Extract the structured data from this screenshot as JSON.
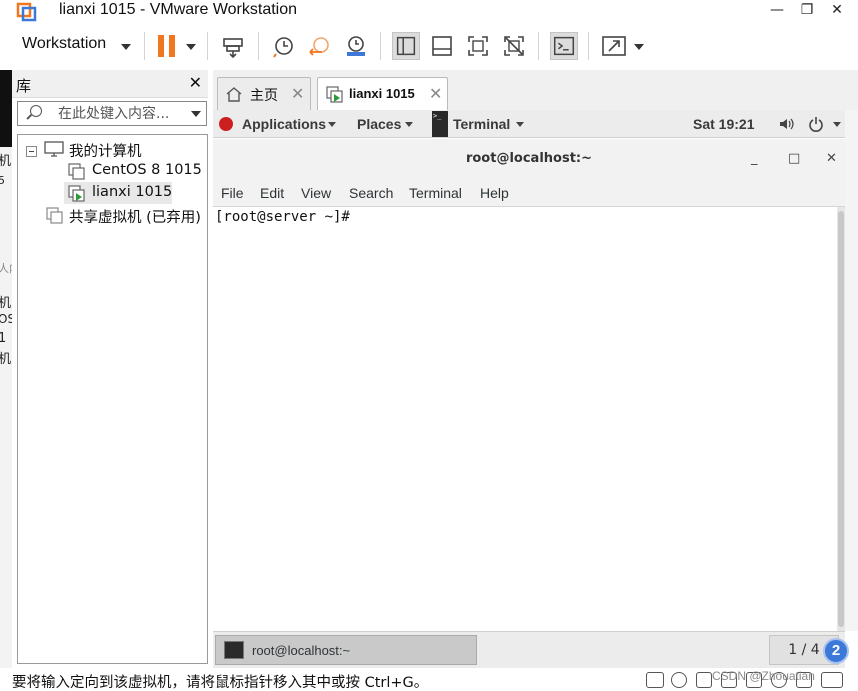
{
  "window": {
    "title": "lianxi 1015 - VMware Workstation",
    "minimize_glyph": "—",
    "restore_glyph": "❐",
    "close_glyph": "✕"
  },
  "toolbar": {
    "menu_label": "Workstation",
    "buttons": [
      "pause-vm",
      "send-ctrl-alt-del",
      "snapshot",
      "revert-snapshot",
      "manage-snapshots",
      "show-library",
      "thumbnail-bar",
      "full-screen",
      "unity",
      "console-view",
      "stretch-guest"
    ]
  },
  "library": {
    "title": "库",
    "close_glyph": "✕",
    "search_placeholder": "在此处键入内容...",
    "tree": [
      {
        "label": "我的计算机",
        "icon": "computer-icon"
      },
      {
        "label": "CentOS 8 1015",
        "icon": "vm-icon"
      },
      {
        "label": "lianxi 1015",
        "icon": "vm-running-icon",
        "selected": true
      },
      {
        "label": "共享虚拟机 (已弃用)",
        "icon": "shared-vm-icon"
      }
    ]
  },
  "tabs": [
    {
      "label": "主页",
      "icon": "home-icon",
      "close": "✕"
    },
    {
      "label": "lianxi 1015",
      "icon": "vm-running-icon",
      "close": "✕",
      "active": true
    }
  ],
  "guest": {
    "topbar": {
      "applications": "Applications",
      "places": "Places",
      "terminal": "Terminal",
      "clock": "Sat 19:21"
    },
    "window_title": "root@localhost:~",
    "window_controls": {
      "minimize": "_",
      "maximize": "□",
      "close": "✕"
    },
    "menu": [
      "File",
      "Edit",
      "View",
      "Search",
      "Terminal",
      "Help"
    ],
    "prompt": "[root@server ~]#",
    "taskbar_item": "root@localhost:~",
    "pager": "1 / 4"
  },
  "help_badge": "2",
  "status": {
    "message": "要将输入定向到该虚拟机，请将鼠标指针移入其中或按 Ctrl+G。"
  },
  "watermark": "CSDN @Zhouatian",
  "background_fragments": [
    "机",
    "5",
    "人内",
    "机",
    "OS",
    "1",
    "机"
  ],
  "colors": {
    "accent_orange": "#f0761f",
    "badge_blue": "#3c78d8",
    "redhat_red": "#cc1f1f"
  }
}
